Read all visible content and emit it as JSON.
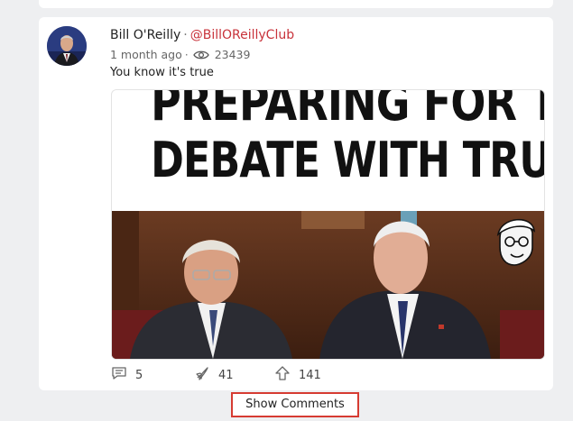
{
  "post": {
    "author": "Bill O'Reilly",
    "separator": "·",
    "handle": "@BillOReillyClub",
    "time": "1 month ago",
    "views": "23439",
    "text": "You know it's true",
    "image": {
      "headline_line1": "PREPARING FOR THE",
      "headline_line2": "DEBATE WITH TRUMP"
    },
    "actions": {
      "comments": "5",
      "shares": "41",
      "upvotes": "141"
    }
  },
  "show_comments_label": "Show Comments",
  "colors": {
    "handle": "#c8323a",
    "highlight_border": "#d63b32",
    "background": "#eeeff1"
  }
}
